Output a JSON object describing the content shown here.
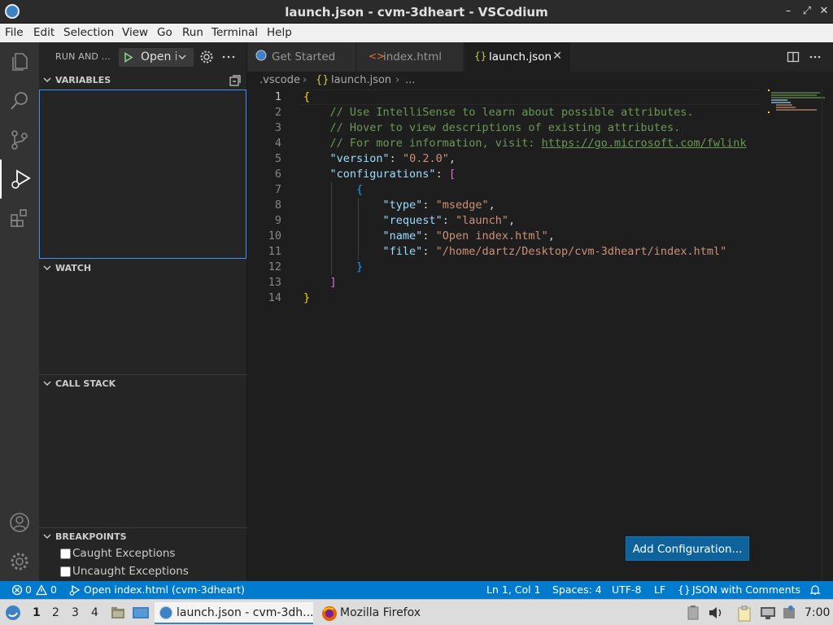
{
  "window": {
    "title": "launch.json - cvm-3dheart - VSCodium"
  },
  "menu": [
    "File",
    "Edit",
    "Selection",
    "View",
    "Go",
    "Run",
    "Terminal",
    "Help"
  ],
  "sidebar": {
    "title": "RUN AND ...",
    "launch_config": "Open i",
    "sections": {
      "variables": "VARIABLES",
      "watch": "WATCH",
      "call_stack": "CALL STACK",
      "breakpoints": "BREAKPOINTS"
    },
    "breakpoints": [
      {
        "label": "Caught Exceptions",
        "checked": false
      },
      {
        "label": "Uncaught Exceptions",
        "checked": false
      }
    ]
  },
  "tabs": [
    {
      "label": "Get Started",
      "icon": "vscodium-icon"
    },
    {
      "label": "index.html",
      "icon": "html-icon"
    },
    {
      "label": "launch.json",
      "icon": "json-icon",
      "active": true
    }
  ],
  "breadcrumb": [
    ".vscode",
    "launch.json",
    "..."
  ],
  "editor": {
    "lines": [
      [
        [
          "b1",
          "{"
        ]
      ],
      [
        [
          "cm",
          "    // Use IntelliSense to learn about possible attributes."
        ]
      ],
      [
        [
          "cm",
          "    // Hover to view descriptions of existing attributes."
        ]
      ],
      [
        [
          "cm",
          "    // For more information, visit: "
        ],
        [
          "link",
          "https://go.microsoft.com/fwlink"
        ]
      ],
      [
        [
          "txt",
          "    "
        ],
        [
          "key",
          "\"version\""
        ],
        [
          "txt",
          ": "
        ],
        [
          "str",
          "\"0.2.0\""
        ],
        [
          "txt",
          ","
        ]
      ],
      [
        [
          "txt",
          "    "
        ],
        [
          "key",
          "\"configurations\""
        ],
        [
          "txt",
          ": "
        ],
        [
          "b2",
          "["
        ]
      ],
      [
        [
          "txt",
          "        "
        ],
        [
          "b3",
          "{"
        ]
      ],
      [
        [
          "txt",
          "            "
        ],
        [
          "key",
          "\"type\""
        ],
        [
          "txt",
          ": "
        ],
        [
          "str",
          "\"msedge\""
        ],
        [
          "txt",
          ","
        ]
      ],
      [
        [
          "txt",
          "            "
        ],
        [
          "key",
          "\"request\""
        ],
        [
          "txt",
          ": "
        ],
        [
          "str",
          "\"launch\""
        ],
        [
          "txt",
          ","
        ]
      ],
      [
        [
          "txt",
          "            "
        ],
        [
          "key",
          "\"name\""
        ],
        [
          "txt",
          ": "
        ],
        [
          "str",
          "\"Open index.html\""
        ],
        [
          "txt",
          ","
        ]
      ],
      [
        [
          "txt",
          "            "
        ],
        [
          "key",
          "\"file\""
        ],
        [
          "txt",
          ": "
        ],
        [
          "str",
          "\"/home/dartz/Desktop/cvm-3dheart/index.html\""
        ]
      ],
      [
        [
          "txt",
          "        "
        ],
        [
          "b3",
          "}"
        ]
      ],
      [
        [
          "txt",
          "    "
        ],
        [
          "b2",
          "]"
        ]
      ],
      [
        [
          "b1",
          "}"
        ]
      ]
    ],
    "current_line": 1,
    "add_config_label": "Add Configuration..."
  },
  "statusbar": {
    "errors": "0",
    "warnings": "0",
    "debug_target": "Open index.html (cvm-3dheart)",
    "position": "Ln 1, Col 1",
    "spaces": "Spaces: 4",
    "encoding": "UTF-8",
    "eol": "LF",
    "language": "JSON with Comments"
  },
  "taskbar": {
    "workspaces": [
      "1",
      "2",
      "3",
      "4"
    ],
    "tasks": [
      {
        "label": "launch.json - cvm-3dh...",
        "active": true
      },
      {
        "label": "Mozilla Firefox",
        "active": false
      }
    ],
    "clock": "7:00"
  }
}
